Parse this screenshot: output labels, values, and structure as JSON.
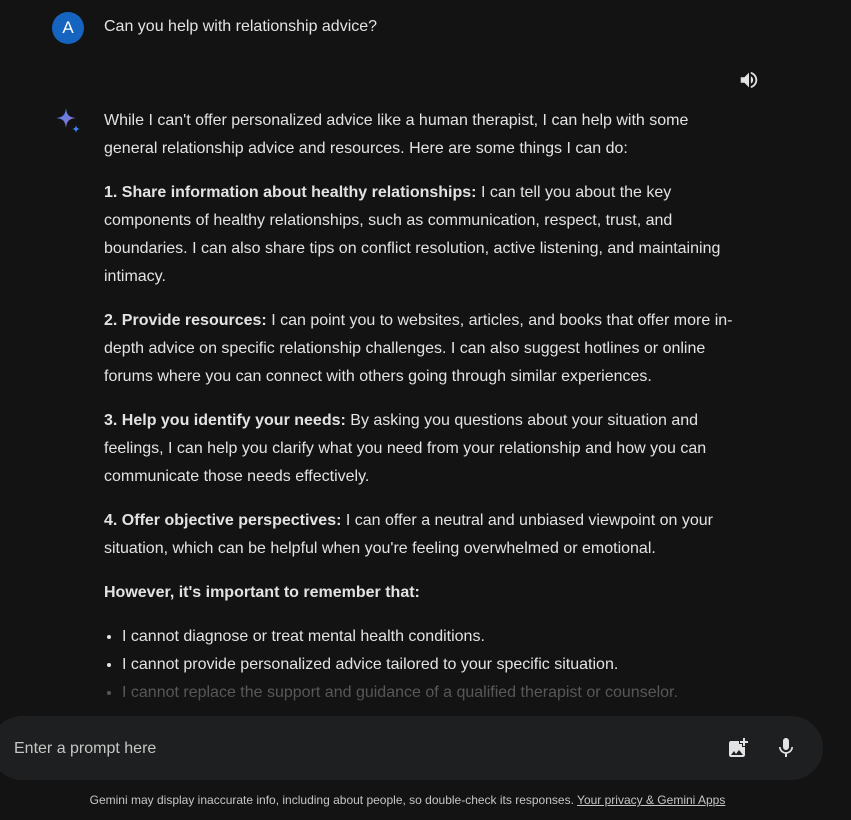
{
  "user_turn": {
    "avatar_letter": "A",
    "query": "Can you help with relationship advice?"
  },
  "response": {
    "speaker_icon": "volume-up-icon",
    "logo_icon": "gemini-sparkle-icon",
    "intro": "While I can't offer personalized advice like a human therapist, I can help with some general relationship advice and resources. Here are some things I can do:",
    "points": [
      {
        "heading": "1. Share information about healthy relationships:",
        "text": " I can tell you about the key components of healthy relationships, such as communication, respect, trust, and boundaries. I can also share tips on conflict resolution, active listening, and maintaining intimacy."
      },
      {
        "heading": "2. Provide resources:",
        "text": " I can point you to websites, articles, and books that offer more in-depth advice on specific relationship challenges. I can also suggest hotlines or online forums where you can connect with others going through similar experiences."
      },
      {
        "heading": "3. Help you identify your needs:",
        "text": " By asking you questions about your situation and feelings, I can help you clarify what you need from your relationship and how you can communicate those needs effectively."
      },
      {
        "heading": "4. Offer objective perspectives:",
        "text": " I can offer a neutral and unbiased viewpoint on your situation, which can be helpful when you're feeling overwhelmed or emotional."
      }
    ],
    "caveat_heading": "However, it's important to remember that:",
    "bullets": [
      "I cannot diagnose or treat mental health conditions.",
      "I cannot provide personalized advice tailored to your specific situation.",
      "I cannot replace the support and guidance of a qualified therapist or counselor."
    ]
  },
  "prompt_bar": {
    "placeholder": "Enter a prompt here",
    "value": "",
    "image_icon": "add-image-icon",
    "mic_icon": "microphone-icon"
  },
  "footer": {
    "disclaimer": "Gemini may display inaccurate info, including about people, so double-check its responses.",
    "privacy_link": "Your privacy & Gemini Apps"
  },
  "colors": {
    "background": "#131314",
    "prompt_bar": "#1e1f20",
    "avatar": "#1565c0",
    "text": "#e3e3e3",
    "sparkle_primary": "#4285f4",
    "sparkle_secondary": "#9b72cb"
  }
}
